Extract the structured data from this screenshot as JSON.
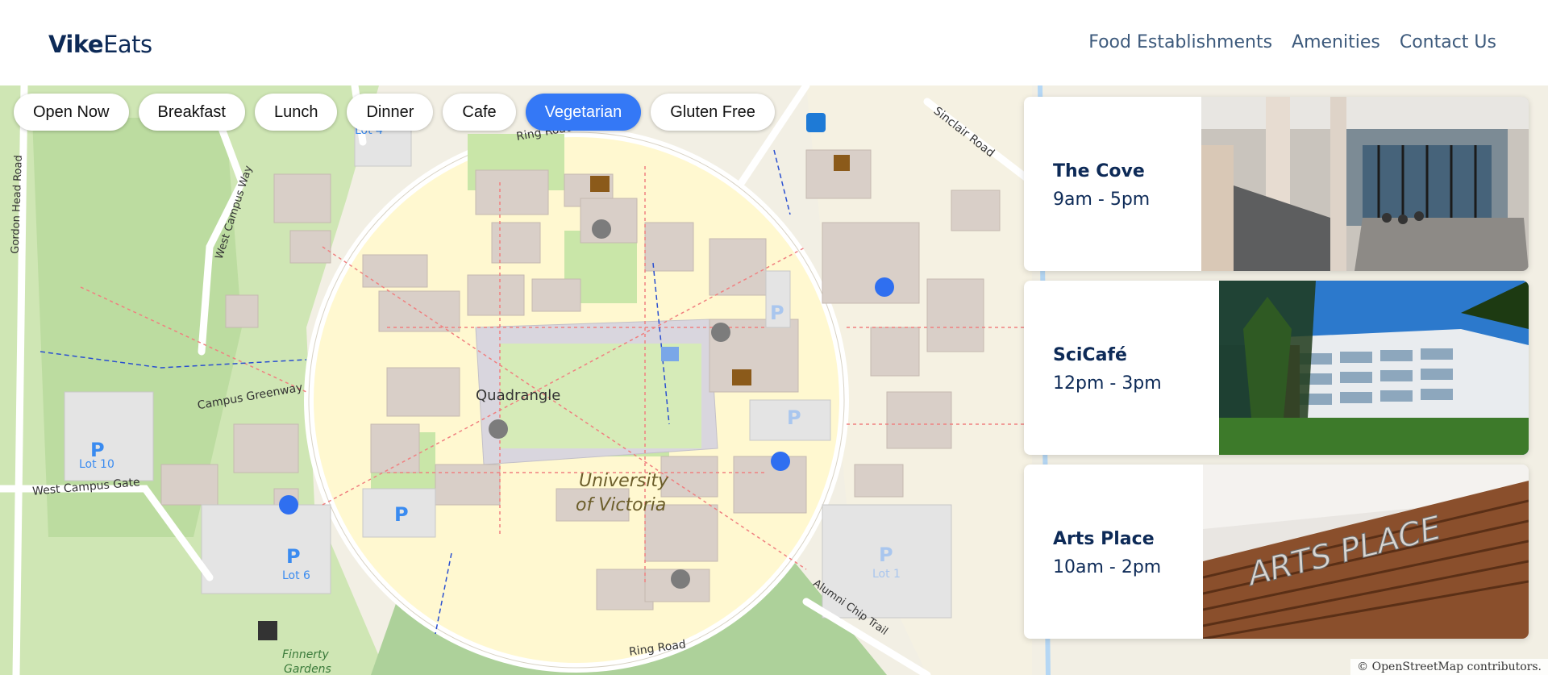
{
  "brand": {
    "bold": "Vike",
    "rest": "Eats"
  },
  "nav": [
    {
      "label": "Food Establishments"
    },
    {
      "label": "Amenities"
    },
    {
      "label": "Contact Us"
    }
  ],
  "filters": [
    {
      "label": "Open Now",
      "active": false
    },
    {
      "label": "Breakfast",
      "active": false
    },
    {
      "label": "Lunch",
      "active": false
    },
    {
      "label": "Dinner",
      "active": false
    },
    {
      "label": "Cafe",
      "active": false
    },
    {
      "label": "Vegetarian",
      "active": true
    },
    {
      "label": "Gluten Free",
      "active": false
    }
  ],
  "map": {
    "labels": {
      "quadrangle": "Quadrangle",
      "university": "University",
      "of_victoria": "of Victoria",
      "ring_road": "Ring Road",
      "sinclair_road": "Sinclair Road",
      "campus_greenway": "Campus Greenway",
      "west_campus_way": "West Campus Way",
      "west_campus_gate": "West Campus Gate",
      "gordon_head_road": "Gordon Head Road",
      "alumni_chip_trail": "Alumni Chip Trail",
      "lot_1": "Lot 1",
      "lot_4": "Lot 4",
      "lot_6": "Lot 6",
      "lot_10": "Lot 10",
      "finnerty": "Finnerty",
      "gardens": "Gardens",
      "parking": "P"
    },
    "attribution": "© OpenStreetMap contributors."
  },
  "establishments": [
    {
      "name": "The Cove",
      "hours": "9am - 5pm",
      "photo": "atrium-photo"
    },
    {
      "name": "SciCafé",
      "hours": "12pm - 3pm",
      "photo": "building-photo"
    },
    {
      "name": "Arts Place",
      "hours": "10am - 2pm",
      "photo": "arts-place-sign-photo",
      "sign_text": "ARTS PLACE"
    }
  ],
  "colors": {
    "brand": "#0d2a57",
    "accent": "#3478f6",
    "marker_open": "#2f6ff0",
    "marker_closed": "#7c7c7c"
  }
}
